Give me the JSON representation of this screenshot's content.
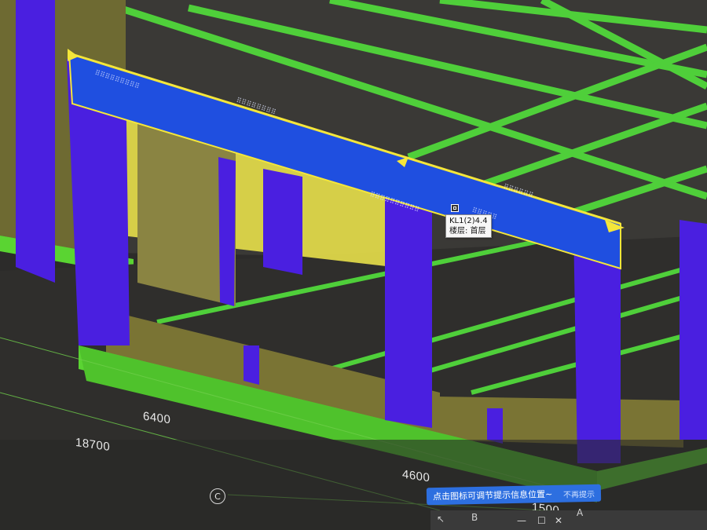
{
  "scene": {
    "dimensions": {
      "d1": "6400",
      "d2": "18700",
      "d3": "4600",
      "d4": "1500"
    },
    "axis_bubble": "C",
    "axis_letters": {
      "b": "B",
      "a": "A"
    }
  },
  "tooltip": {
    "name": "KL1(2)4.4",
    "floor": "楼层: 首层"
  },
  "hint": {
    "message": "点击图标可调节提示信息位置~",
    "dismiss": "不再提示"
  },
  "window_controls": {
    "minimize": "—",
    "restore": "☐",
    "close": "✕"
  },
  "colors": {
    "column": "#4a1fe0",
    "beam": "#1f4fe0",
    "floor_edge": "#5ad432",
    "wall": "#7a7434",
    "slab": "#3b3a37",
    "grid_line": "#4fcf3a",
    "highlight": "#f4e63a",
    "hint_bar": "#2d6fe0"
  }
}
